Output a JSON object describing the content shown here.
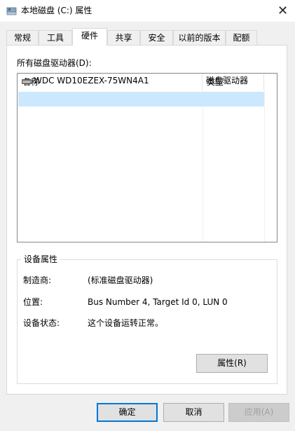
{
  "window": {
    "title": "本地磁盘 (C:) 属性",
    "close_glyph": "✕"
  },
  "tabs": [
    {
      "label": "常规",
      "active": false
    },
    {
      "label": "工具",
      "active": false
    },
    {
      "label": "硬件",
      "active": true
    },
    {
      "label": "共享",
      "active": false
    },
    {
      "label": "安全",
      "active": false
    },
    {
      "label": "以前的版本",
      "active": false
    },
    {
      "label": "配额",
      "active": false
    }
  ],
  "hardware": {
    "drives_label": "所有磁盘驱动器(D):",
    "columns": {
      "name": "名称",
      "type": "类型"
    },
    "rows": [
      {
        "name": "WDC WD10EZEX-75WN4A1",
        "type": "磁盘驱动器",
        "selected": true,
        "icon": "drive-icon"
      }
    ]
  },
  "device_properties": {
    "group_title": "设备属性",
    "manufacturer_label": "制造商:",
    "manufacturer_value": "(标准磁盘驱动器)",
    "location_label": "位置:",
    "location_value": "Bus Number 4, Target Id 0, LUN 0",
    "status_label": "设备状态:",
    "status_value": "这个设备运转正常。",
    "properties_button": "属性(R)"
  },
  "footer": {
    "ok": "确定",
    "cancel": "取消",
    "apply": "应用(A)",
    "apply_enabled": false
  },
  "colors": {
    "selection": "#cce8ff",
    "accent": "#0078d7"
  }
}
